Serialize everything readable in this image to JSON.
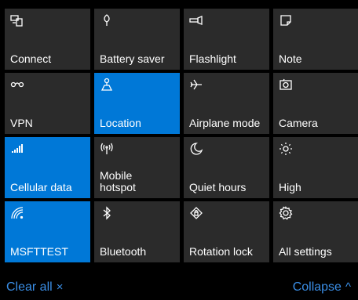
{
  "tiles": [
    {
      "label": "Connect",
      "icon": "connect-icon",
      "active": false
    },
    {
      "label": "Battery saver",
      "icon": "battery-saver-icon",
      "active": false
    },
    {
      "label": "Flashlight",
      "icon": "flashlight-icon",
      "active": false
    },
    {
      "label": "Note",
      "icon": "note-icon",
      "active": false
    },
    {
      "label": "VPN",
      "icon": "vpn-icon",
      "active": false
    },
    {
      "label": "Location",
      "icon": "location-icon",
      "active": true
    },
    {
      "label": "Airplane mode",
      "icon": "airplane-icon",
      "active": false
    },
    {
      "label": "Camera",
      "icon": "camera-icon",
      "active": false
    },
    {
      "label": "Cellular data",
      "icon": "cellular-signal-icon",
      "active": true
    },
    {
      "label": "Mobile\nhotspot",
      "icon": "mobile-hotspot-icon",
      "active": false
    },
    {
      "label": "Quiet hours",
      "icon": "moon-icon",
      "active": false
    },
    {
      "label": "High",
      "icon": "brightness-icon",
      "active": false
    },
    {
      "label": "MSFTTEST",
      "icon": "wifi-icon",
      "active": true
    },
    {
      "label": "Bluetooth",
      "icon": "bluetooth-icon",
      "active": false
    },
    {
      "label": "Rotation lock",
      "icon": "rotation-lock-icon",
      "active": false
    },
    {
      "label": "All settings",
      "icon": "settings-gear-icon",
      "active": false
    }
  ],
  "footer": {
    "clear_all": "Clear all",
    "clear_all_glyph": "×",
    "collapse": "Collapse",
    "collapse_glyph": "^"
  },
  "colors": {
    "tile": "#2b2b2b",
    "active_tile": "#0078d7",
    "link": "#3a8ee6",
    "background": "#000000"
  }
}
